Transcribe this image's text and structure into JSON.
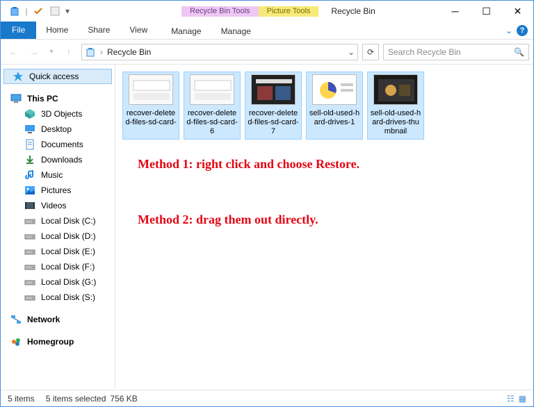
{
  "title": "Recycle Bin",
  "context_tabs": {
    "purple": "Recycle Bin Tools",
    "yellow": "Picture Tools",
    "purple_sub": "Manage",
    "yellow_sub": "Manage"
  },
  "ribbon": {
    "file": "File",
    "home": "Home",
    "share": "Share",
    "view": "View"
  },
  "nav": {
    "crumb": "Recycle Bin",
    "search_placeholder": "Search Recycle Bin"
  },
  "sidebar": {
    "quick": "Quick access",
    "pc": "This PC",
    "items": [
      {
        "label": "3D Objects",
        "icon": "cube"
      },
      {
        "label": "Desktop",
        "icon": "desktop"
      },
      {
        "label": "Documents",
        "icon": "doc"
      },
      {
        "label": "Downloads",
        "icon": "down"
      },
      {
        "label": "Music",
        "icon": "music"
      },
      {
        "label": "Pictures",
        "icon": "pic"
      },
      {
        "label": "Videos",
        "icon": "video"
      },
      {
        "label": "Local Disk (C:)",
        "icon": "drive"
      },
      {
        "label": "Local Disk (D:)",
        "icon": "drive"
      },
      {
        "label": "Local Disk (E:)",
        "icon": "drive"
      },
      {
        "label": "Local Disk (F:)",
        "icon": "drive"
      },
      {
        "label": "Local Disk (G:)",
        "icon": "drive"
      },
      {
        "label": "Local Disk (S:)",
        "icon": "drive"
      }
    ],
    "network": "Network",
    "homegroup": "Homegroup"
  },
  "files": [
    {
      "name": "recover-deleted-files-sd-card-",
      "thumb": "whitebox"
    },
    {
      "name": "recover-deleted-files-sd-card-6",
      "thumb": "whitebox"
    },
    {
      "name": "recover-deleted-files-sd-card-7",
      "thumb": "darkframe"
    },
    {
      "name": "sell-old-used-hard-drives-1",
      "thumb": "pie"
    },
    {
      "name": "sell-old-used-hard-drives-thumbnail",
      "thumb": "photo"
    }
  ],
  "annotation": {
    "line1": "Method 1: right click and choose Restore.",
    "line2": "Method 2: drag them out directly."
  },
  "status": {
    "count": "5 items",
    "selected": "5 items selected",
    "size": "756 KB"
  },
  "colors": {
    "accent": "#1979ca",
    "selection": "#cce8ff",
    "annot": "#e30613"
  }
}
